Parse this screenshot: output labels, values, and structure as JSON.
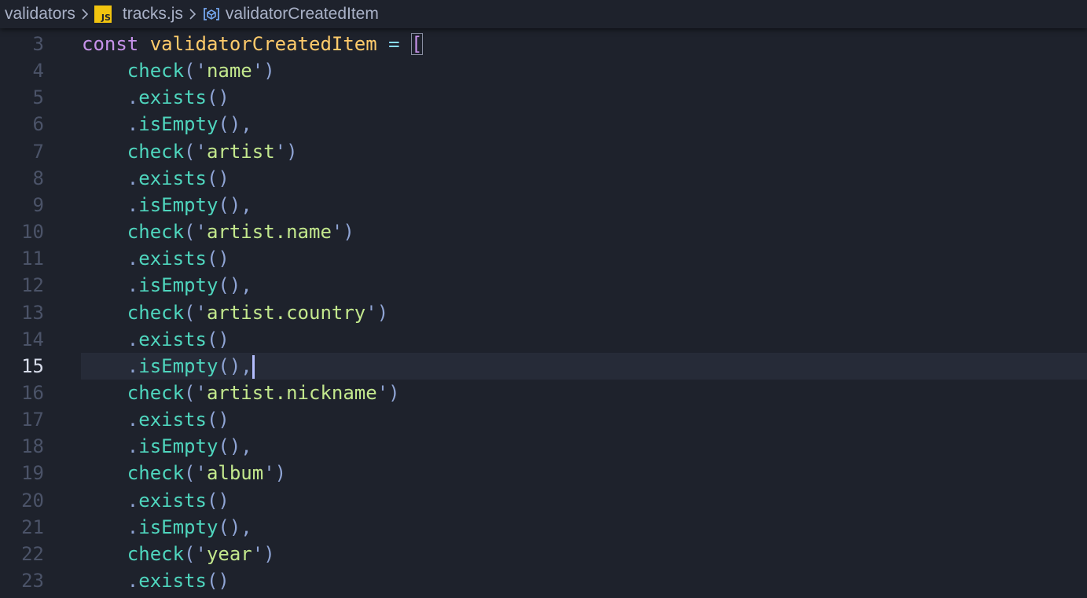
{
  "breadcrumb": {
    "folder": "validators",
    "file_badge": "JS",
    "file": "tracks.js",
    "symbol": "validatorCreatedItem"
  },
  "icons": {
    "separator": "chevron-right-icon",
    "file": "javascript-file-icon",
    "symbol": "variable-symbol-icon"
  },
  "colors": {
    "background": "#1e222c",
    "current_line": "#262b38",
    "keyword": "#c792ea",
    "variable": "#ffcb6b",
    "function": "#4fd6be",
    "string": "#c3e88d",
    "punctuation": "#8fa4d4",
    "line_number": "#4b5368"
  },
  "editor": {
    "current_line": 15,
    "lines": [
      {
        "num": "3",
        "kw": "const ",
        "var": "validatorCreatedItem",
        "op": " = ",
        "bracket": "["
      },
      {
        "num": "4",
        "indent": "    ",
        "fn": "check",
        "open": "('",
        "str": "name",
        "close": "')"
      },
      {
        "num": "5",
        "indent": "    ",
        "dot": ".",
        "method": "exists",
        "tail": "()"
      },
      {
        "num": "6",
        "indent": "    ",
        "dot": ".",
        "method": "isEmpty",
        "tail": "(),"
      },
      {
        "num": "7",
        "indent": "    ",
        "fn": "check",
        "open": "('",
        "str": "artist",
        "close": "')"
      },
      {
        "num": "8",
        "indent": "    ",
        "dot": ".",
        "method": "exists",
        "tail": "()"
      },
      {
        "num": "9",
        "indent": "    ",
        "dot": ".",
        "method": "isEmpty",
        "tail": "(),"
      },
      {
        "num": "10",
        "indent": "    ",
        "fn": "check",
        "open": "('",
        "str": "artist.name",
        "close": "')"
      },
      {
        "num": "11",
        "indent": "    ",
        "dot": ".",
        "method": "exists",
        "tail": "()"
      },
      {
        "num": "12",
        "indent": "    ",
        "dot": ".",
        "method": "isEmpty",
        "tail": "(),"
      },
      {
        "num": "13",
        "indent": "    ",
        "fn": "check",
        "open": "('",
        "str": "artist.country",
        "close": "')"
      },
      {
        "num": "14",
        "indent": "    ",
        "dot": ".",
        "method": "exists",
        "tail": "()"
      },
      {
        "num": "15",
        "indent": "    ",
        "dot": ".",
        "method": "isEmpty",
        "tail": "(),",
        "cursor": true
      },
      {
        "num": "16",
        "indent": "    ",
        "fn": "check",
        "open": "('",
        "str": "artist.nickname",
        "close": "')"
      },
      {
        "num": "17",
        "indent": "    ",
        "dot": ".",
        "method": "exists",
        "tail": "()"
      },
      {
        "num": "18",
        "indent": "    ",
        "dot": ".",
        "method": "isEmpty",
        "tail": "(),"
      },
      {
        "num": "19",
        "indent": "    ",
        "fn": "check",
        "open": "('",
        "str": "album",
        "close": "')"
      },
      {
        "num": "20",
        "indent": "    ",
        "dot": ".",
        "method": "exists",
        "tail": "()"
      },
      {
        "num": "21",
        "indent": "    ",
        "dot": ".",
        "method": "isEmpty",
        "tail": "(),"
      },
      {
        "num": "22",
        "indent": "    ",
        "fn": "check",
        "open": "('",
        "str": "year",
        "close": "')"
      },
      {
        "num": "23",
        "indent": "    ",
        "dot": ".",
        "method": "exists",
        "tail": "()"
      }
    ]
  }
}
